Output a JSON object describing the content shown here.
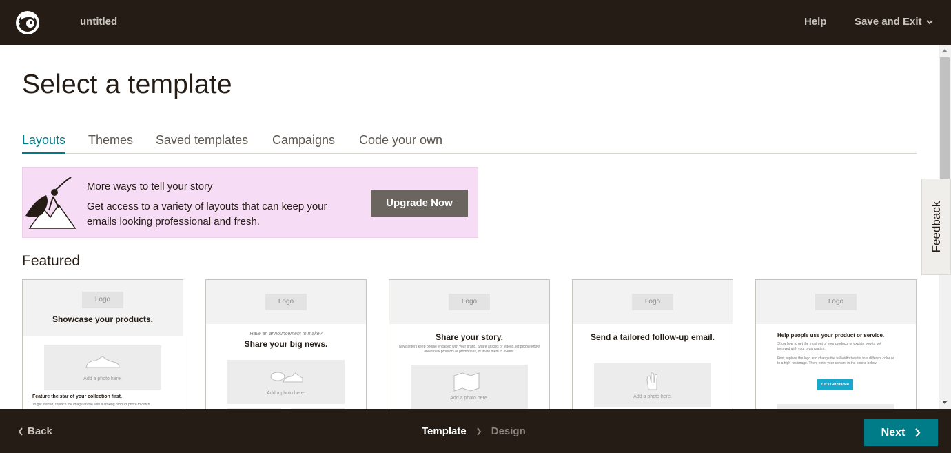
{
  "header": {
    "doc_title": "untitled",
    "help_label": "Help",
    "save_exit_label": "Save and Exit"
  },
  "main": {
    "title": "Select a template",
    "tabs": [
      {
        "label": "Layouts",
        "active": true
      },
      {
        "label": "Themes",
        "active": false
      },
      {
        "label": "Saved templates",
        "active": false
      },
      {
        "label": "Campaigns",
        "active": false
      },
      {
        "label": "Code your own",
        "active": false
      }
    ],
    "promo": {
      "title": "More ways to tell your story",
      "body": "Get access to a variety of layouts that can keep your emails looking professional and fresh.",
      "button_label": "Upgrade Now"
    },
    "featured_heading": "Featured",
    "cards": [
      {
        "logo": "Logo",
        "title": "Showcase your products.",
        "photo_caption": "Add a photo here.",
        "subheading": "Feature the star of your collection first.",
        "body": "To get started, replace the image above with a striking product photo to catch..."
      },
      {
        "logo": "Logo",
        "kicker": "Have an announcement to make?",
        "title": "Share your big news.",
        "photo_caption": "Add a photo here."
      },
      {
        "logo": "Logo",
        "title": "Share your story.",
        "body": "Newsletters keep people engaged with your brand. Share articles or videos, let people know about new products or promotions, or invite them to events.",
        "photo_caption": "Add a photo here."
      },
      {
        "logo": "Logo",
        "title": "Send a tailored follow-up email.",
        "photo_caption": "Add a photo here."
      },
      {
        "logo": "Logo",
        "title": "Help people use your product or service.",
        "body1": "Show how to get the most out of your products or explain how to get involved with your organization.",
        "body2": "First, replace the logo and change the full-width header to a different color or to a high-res image. Then, enter your content in the blocks below.",
        "button_label": "Let's Get Started"
      }
    ],
    "feedback_label": "Feedback"
  },
  "footer": {
    "back_label": "Back",
    "step_current": "Template",
    "step_next": "Design",
    "next_label": "Next"
  },
  "colors": {
    "topbar": "#241c15",
    "accent": "#007c89",
    "promo_bg": "#f7dcf5",
    "upgrade_btn": "#6b6560",
    "card_button": "#19a9ce"
  }
}
